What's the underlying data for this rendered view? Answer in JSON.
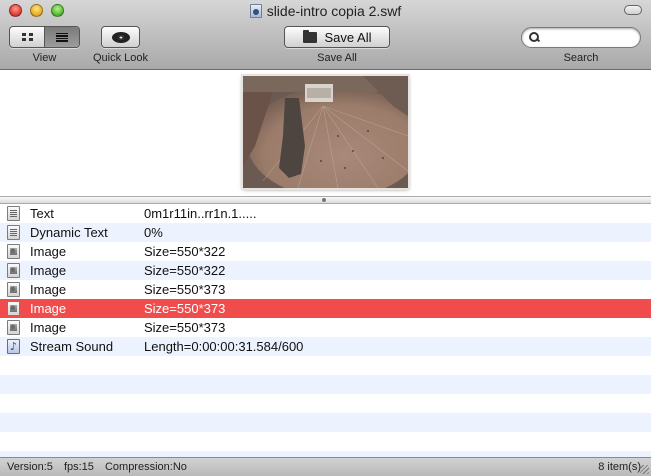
{
  "window": {
    "title": "slide-intro copia 2.swf",
    "file_icon": "swf-file-icon"
  },
  "toolbar": {
    "view_label": "View",
    "quicklook_label": "Quick Look",
    "save_all_button": "Save All",
    "save_all_label": "Save All",
    "search_label": "Search",
    "search_value": "",
    "search_placeholder": "",
    "view_mode": "list"
  },
  "preview": {
    "image": "aerial photo of a brick piazza with tower shadow",
    "colors": {
      "brick": "#9b7b69",
      "shadow": "#4f4540",
      "rooftops": "#6b5a52"
    }
  },
  "items": [
    {
      "type": "Text",
      "value": "0m1r11in..rr1n.1.....",
      "icon": "text-icon",
      "selected": false
    },
    {
      "type": "Dynamic Text",
      "value": "0%",
      "icon": "text-icon",
      "selected": false
    },
    {
      "type": "Image",
      "value": "Size=550*322",
      "icon": "image-icon",
      "selected": false
    },
    {
      "type": "Image",
      "value": "Size=550*322",
      "icon": "image-icon",
      "selected": false
    },
    {
      "type": "Image",
      "value": "Size=550*373",
      "icon": "image-icon",
      "selected": false
    },
    {
      "type": "Image",
      "value": "Size=550*373",
      "icon": "image-icon",
      "selected": true
    },
    {
      "type": "Image",
      "value": "Size=550*373",
      "icon": "image-icon",
      "selected": false
    },
    {
      "type": "Stream Sound",
      "value": "Length=0:00:00:31.584/600",
      "icon": "sound-icon",
      "selected": false
    }
  ],
  "status": {
    "version": "Version:5",
    "fps": "fps:15",
    "compression": "Compression:No",
    "count": "8 item(s)"
  },
  "colors": {
    "selection": "#f14c4c",
    "stripe": "#edf3fe"
  }
}
